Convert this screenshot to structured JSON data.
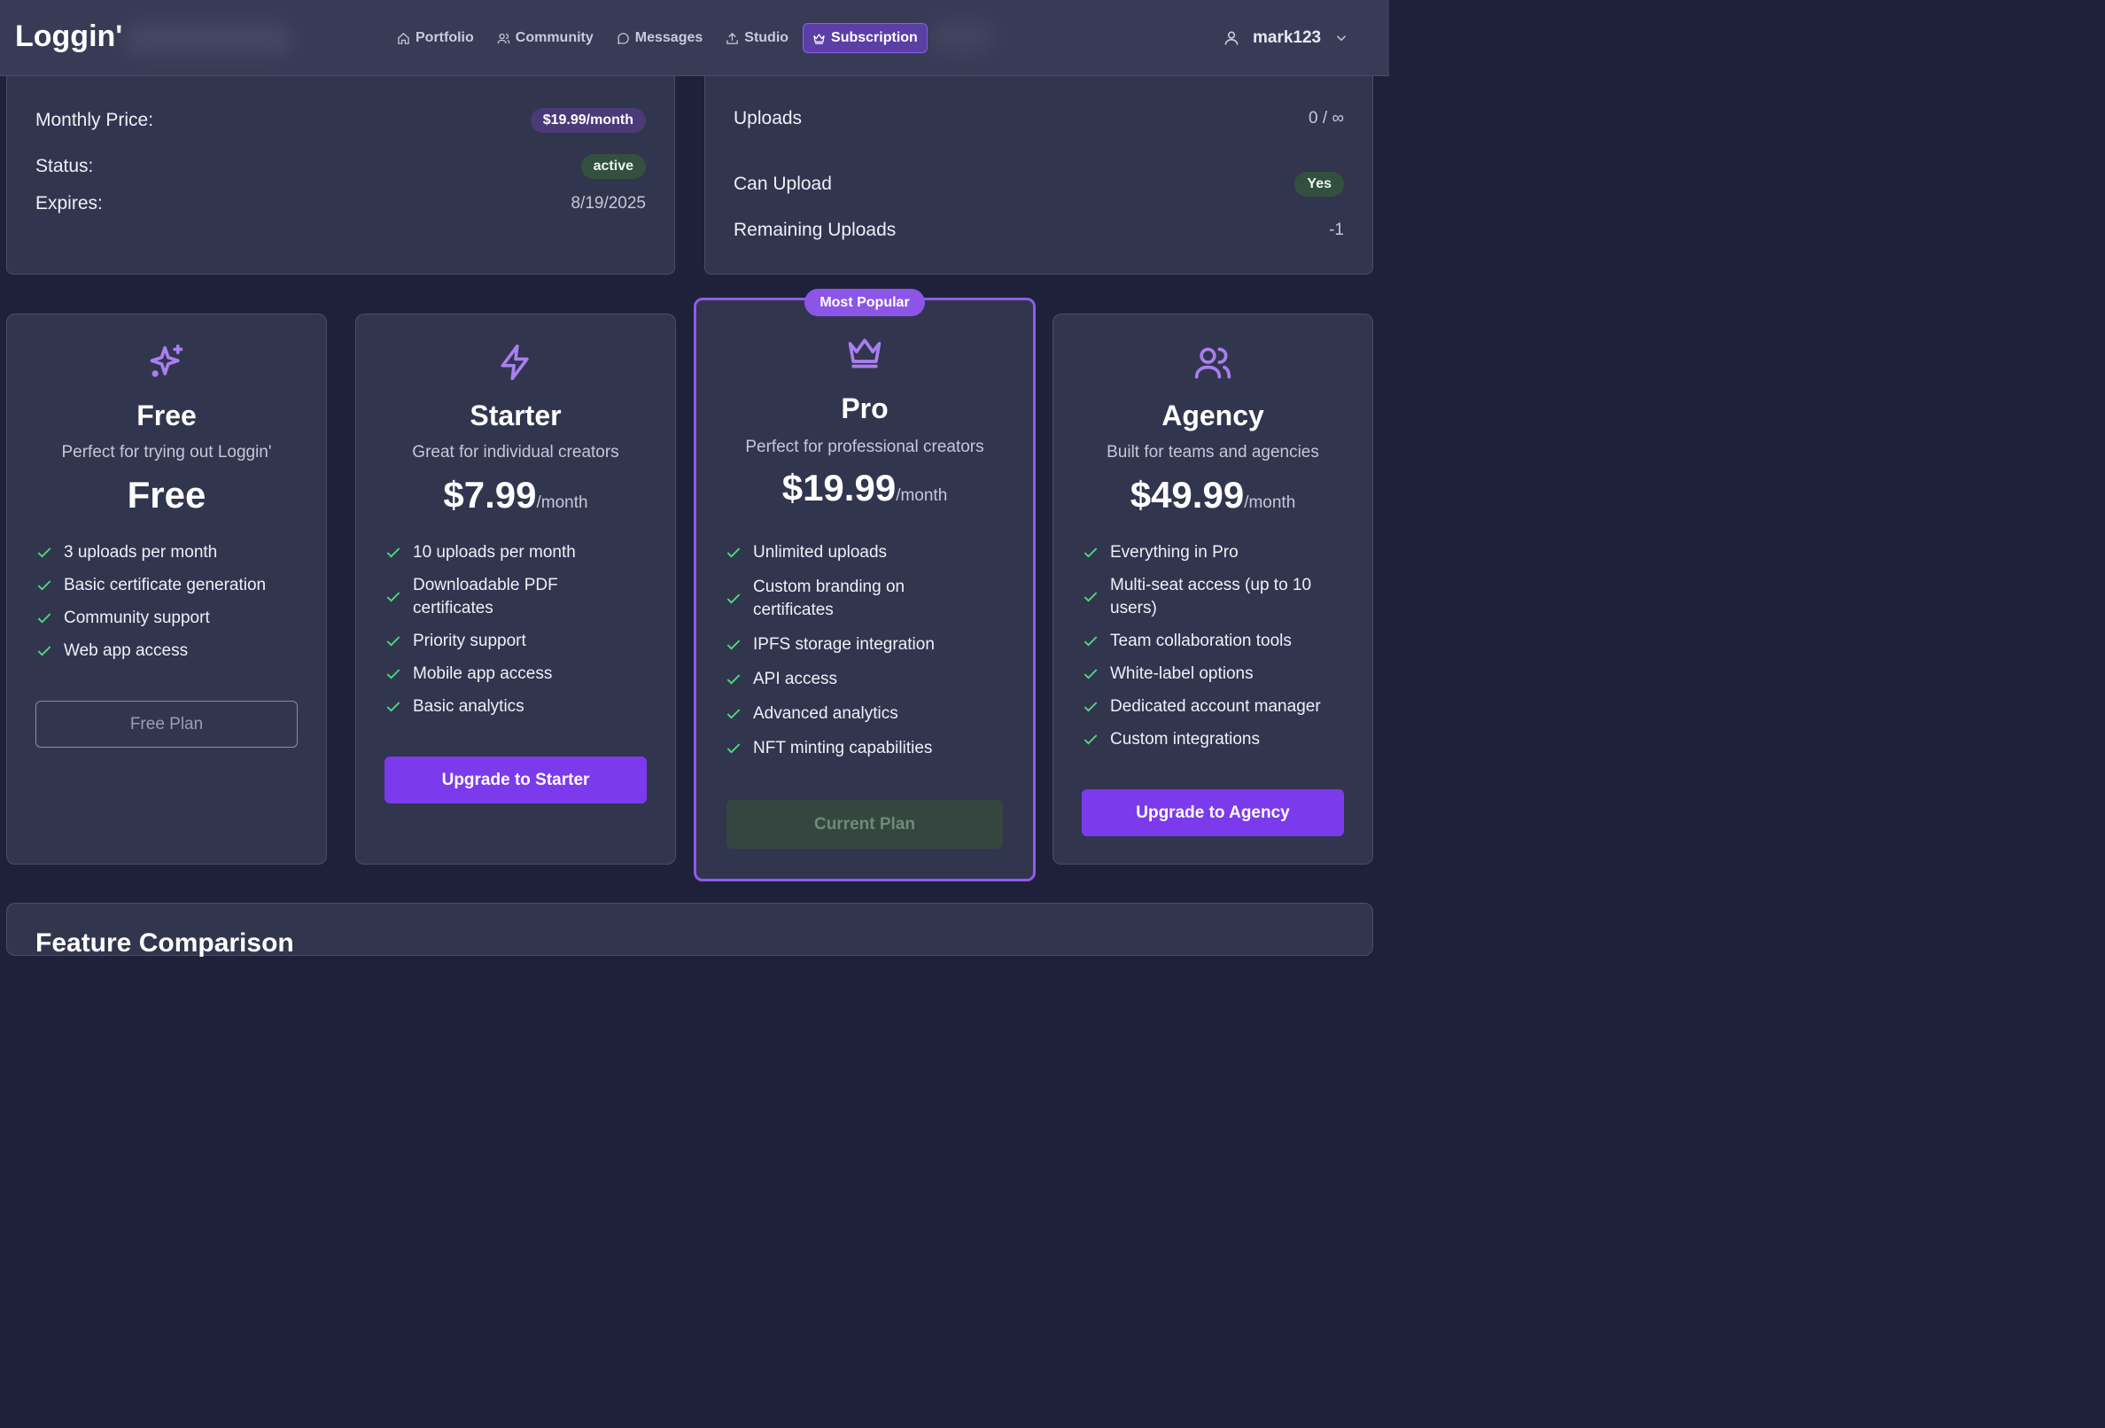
{
  "app": {
    "logo": "Loggin'"
  },
  "nav": [
    {
      "label": "Portfolio",
      "icon": "home-icon"
    },
    {
      "label": "Community",
      "icon": "users-icon"
    },
    {
      "label": "Messages",
      "icon": "message-icon"
    },
    {
      "label": "Studio",
      "icon": "upload-icon"
    },
    {
      "label": "Subscription",
      "icon": "crown-icon",
      "active": true
    }
  ],
  "user": {
    "name": "mark123"
  },
  "subscription": {
    "monthly_price_label": "Monthly Price:",
    "monthly_price_value": "$19.99/month",
    "status_label": "Status:",
    "status_value": "active",
    "expires_label": "Expires:",
    "expires_value": "8/19/2025"
  },
  "usage": {
    "uploads_label": "Uploads",
    "uploads_value": "0 / ∞",
    "can_upload_label": "Can Upload",
    "can_upload_value": "Yes",
    "remaining_label": "Remaining Uploads",
    "remaining_value": "-1"
  },
  "plans": [
    {
      "name": "Free",
      "icon": "sparkles-icon",
      "description": "Perfect for trying out Loggin'",
      "price": "Free",
      "period": "",
      "features": [
        "3 uploads per month",
        "Basic certificate generation",
        "Community support",
        "Web app access"
      ],
      "button": "Free Plan"
    },
    {
      "name": "Starter",
      "icon": "zap-icon",
      "description": "Great for individual creators",
      "price": "$7.99",
      "period": "/month",
      "features": [
        "10 uploads per month",
        "Downloadable PDF certificates",
        "Priority support",
        "Mobile app access",
        "Basic analytics"
      ],
      "button": "Upgrade to Starter"
    },
    {
      "name": "Pro",
      "icon": "crown-icon",
      "description": "Perfect for professional creators",
      "price": "$19.99",
      "period": "/month",
      "badge": "Most Popular",
      "features": [
        "Unlimited uploads",
        "Custom branding on certificates",
        "IPFS storage integration",
        "API access",
        "Advanced analytics",
        "NFT minting capabilities"
      ],
      "button": "Current Plan"
    },
    {
      "name": "Agency",
      "icon": "users-icon",
      "description": "Built for teams and agencies",
      "price": "$49.99",
      "period": "/month",
      "features": [
        "Everything in Pro",
        "Multi-seat access (up to 10 users)",
        "Team collaboration tools",
        "White-label options",
        "Dedicated account manager",
        "Custom integrations"
      ],
      "button": "Upgrade to Agency"
    }
  ],
  "comparison": {
    "title": "Feature Comparison"
  },
  "colors": {
    "accent": "#7c3aed",
    "background": "#1e2139",
    "card": "#32354e",
    "check": "#4ade80"
  }
}
